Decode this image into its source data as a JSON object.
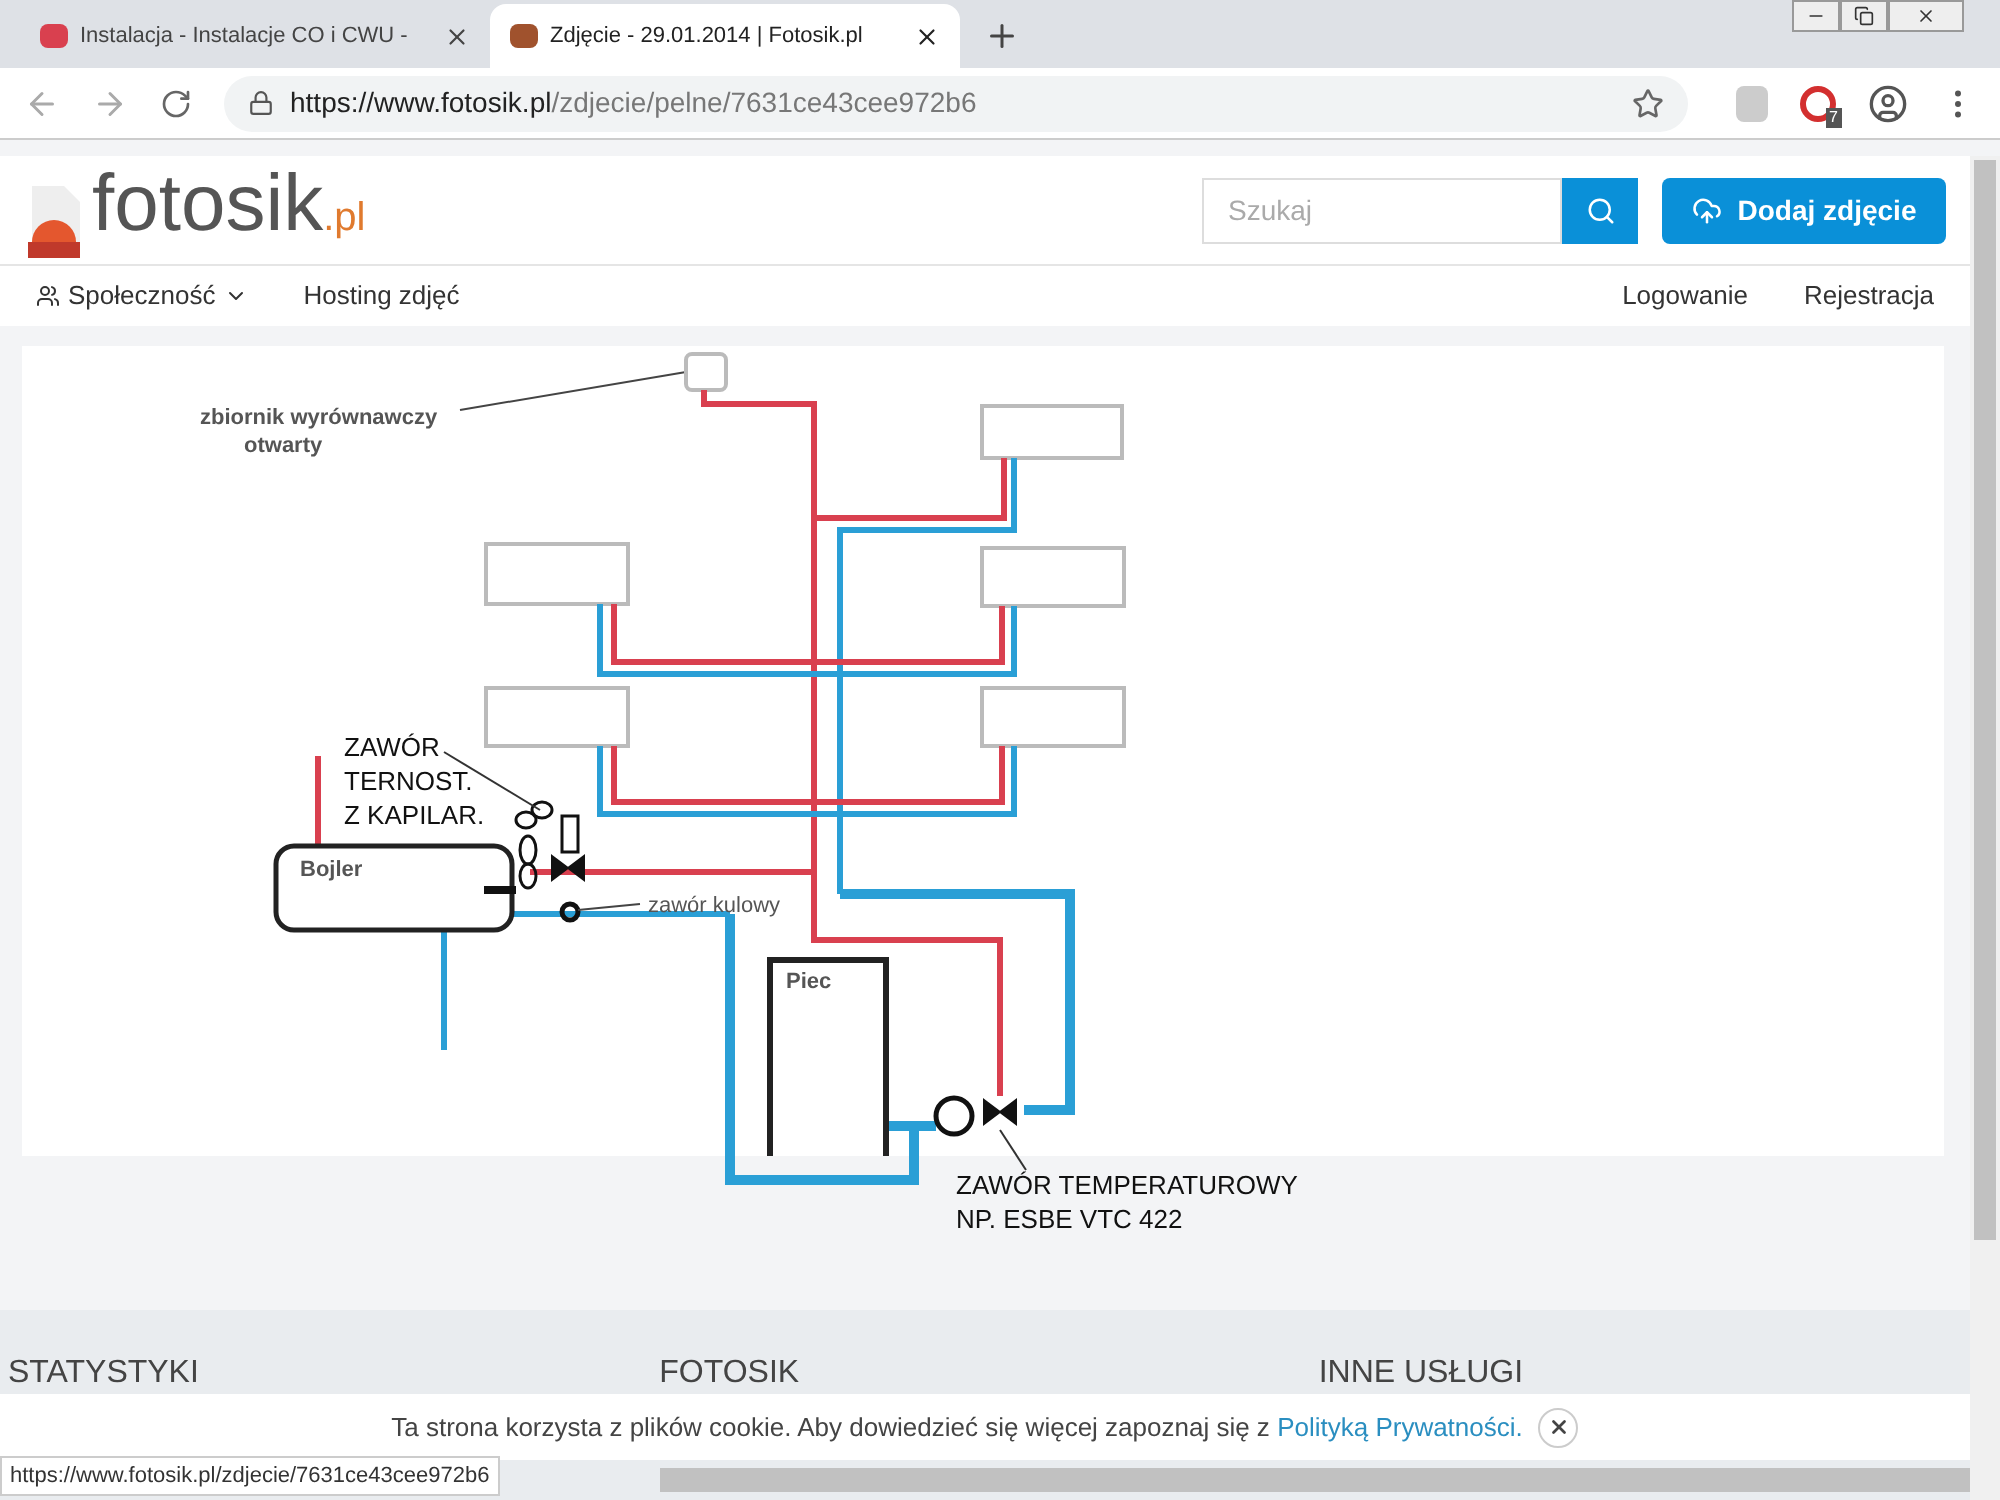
{
  "browser": {
    "tabs": [
      {
        "title": "Instalacja - Instalacje CO i CWU -",
        "selected": false
      },
      {
        "title": "Zdjęcie - 29.01.2014 | Fotosik.pl",
        "selected": true
      }
    ],
    "url": {
      "host": "https://www.fotosik.pl",
      "path": "/zdjecie/pelne/7631ce43cee972b6"
    },
    "extension_badge": "7"
  },
  "header": {
    "logo": {
      "name": "fotosik",
      "suffix": ".pl"
    },
    "search": {
      "placeholder": "Szukaj"
    },
    "upload_button": "Dodaj zdjęcie"
  },
  "nav": {
    "left": [
      {
        "label": "Społeczność",
        "dropdown": true
      },
      {
        "label": "Hosting zdjęć",
        "dropdown": false
      }
    ],
    "right": [
      "Logowanie",
      "Rejestracja"
    ]
  },
  "diagram": {
    "labels": [
      {
        "lines": [
          "zbiornik wyrównawczy",
          "otwarty"
        ]
      },
      {
        "lines": [
          "ZAWÓR",
          "TERNOST.",
          "Z KAPILAR."
        ]
      },
      {
        "lines": [
          "Bojler"
        ]
      },
      {
        "lines": [
          "zawór kulowy"
        ]
      },
      {
        "lines": [
          "Piec"
        ]
      },
      {
        "lines": [
          "ZAWÓR TEMPERATUROWY",
          "NP. ESBE VTC 422"
        ]
      }
    ]
  },
  "footer": {
    "columns": [
      "STATYSTYKI",
      "FOTOSIK",
      "INNE USŁUGI"
    ]
  },
  "cookie_bar": {
    "text": "Ta strona korzysta z plików cookie. Aby dowiedzieć się więcej zapoznaj się z",
    "link": "Polityką Prywatności."
  },
  "status_url": "https://www.fotosik.pl/zdjecie/7631ce43cee972b6"
}
